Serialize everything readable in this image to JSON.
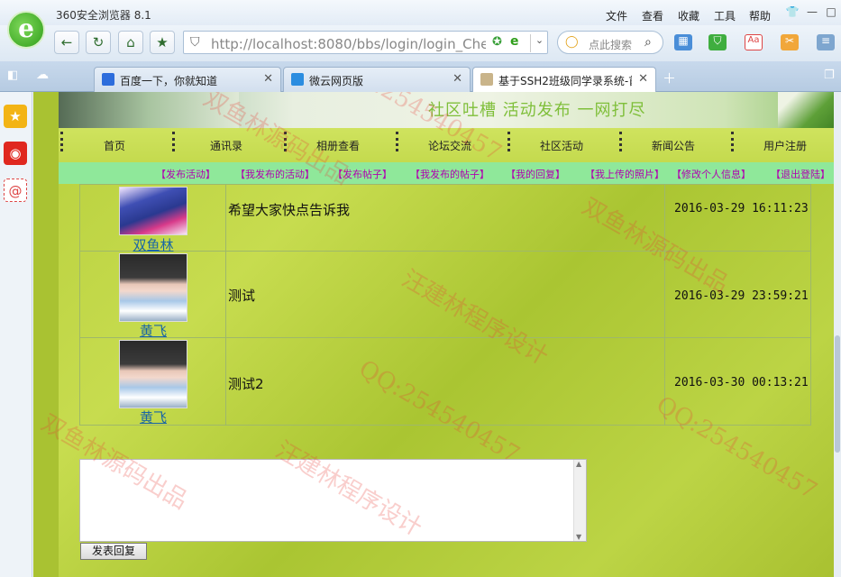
{
  "browser": {
    "title": "360安全浏览器 8.1",
    "menu": [
      "文件",
      "查看",
      "收藏",
      "工具",
      "帮助"
    ],
    "url": "http://localhost:8080/bbs/login/login_Chec",
    "search_placeholder": "点此搜索",
    "tabs": [
      {
        "label": "百度一下，你就知道",
        "active": false
      },
      {
        "label": "微云网页版",
        "active": false
      },
      {
        "label": "基于SSH2班级同学录系统-首页",
        "active": true
      }
    ]
  },
  "site": {
    "slogan": "社区吐槽 活动发布 一网打尽",
    "nav": [
      "首页",
      "通讯录",
      "相册查看",
      "论坛交流",
      "社区活动",
      "新闻公告",
      "用户注册"
    ],
    "subnav": [
      "【发布活动】",
      "【我发布的活动】",
      "【发布帖子】",
      "【我发布的帖子】",
      "【我的回复】",
      "【我上传的照片】",
      "【修改个人信息】",
      "【退出登陆】"
    ]
  },
  "posts": [
    {
      "user": "双鱼林",
      "content": "希望大家快点告诉我",
      "time": "2016-03-29 16:11:23"
    },
    {
      "user": "黄飞",
      "content": "测试",
      "time": "2016-03-29 23:59:21"
    },
    {
      "user": "黄飞",
      "content": "测试2",
      "time": "2016-03-30 00:13:21"
    }
  ],
  "reply": {
    "button": "发表回复"
  },
  "watermarks": [
    "QQ:254540457",
    "双鱼林源码出品",
    "汪建林程序设计",
    "QQ:254540457",
    "汪建林程序设计",
    "双鱼林源码出品",
    "QQ:254540457",
    "双鱼林源码出品"
  ]
}
